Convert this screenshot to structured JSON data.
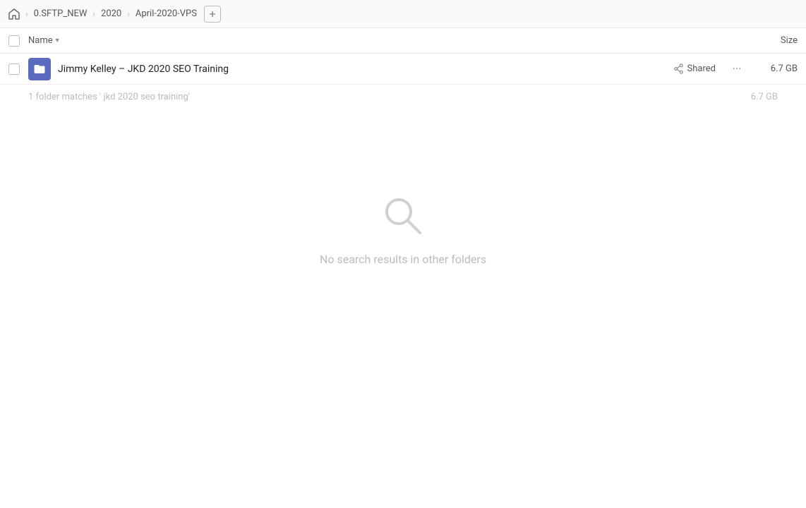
{
  "breadcrumb": {
    "home_icon": "home",
    "items": [
      {
        "label": "0.SFTP_NEW",
        "id": "sftp"
      },
      {
        "label": "2020",
        "id": "2020"
      },
      {
        "label": "April-2020-VPS",
        "id": "april"
      }
    ],
    "add_label": "+"
  },
  "column_header": {
    "name_label": "Name",
    "size_label": "Size"
  },
  "file_row": {
    "name": "Jimmy Kelley – JKD 2020 SEO Training",
    "shared_label": "Shared",
    "size": "6.7 GB"
  },
  "search_note": {
    "text": "1 folder matches ' jkd 2020 seo training'",
    "size": "6.7 GB"
  },
  "empty_state": {
    "text": "No search results in other folders"
  }
}
